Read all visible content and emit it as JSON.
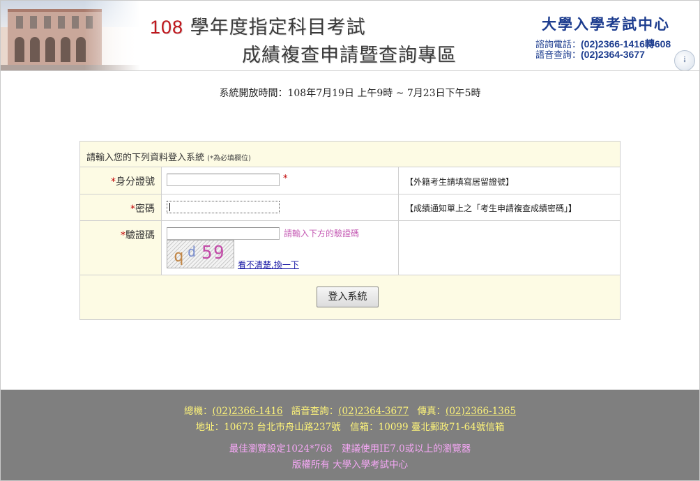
{
  "header": {
    "title_year": "108",
    "title_line1_rest": "學年度指定科目考試",
    "title_line2": "成績複查申請暨查詢專區",
    "center_name": "大學入學考試中心",
    "phone_label": "諮詢電話：",
    "phone_number": "(02)2366-1416轉608",
    "voice_label": "語音查詢：",
    "voice_number": "(02)2364-3677"
  },
  "open_time": "系統開放時間：108年7月19日 上午9時 ~ 7月23日下午5時",
  "login": {
    "caption": "請輸入您的下列資料登入系統",
    "caption_note": "(*為必填欄位)",
    "id_field": {
      "required_mark": "*",
      "label": "身分證號",
      "value": "",
      "after_mark": "*",
      "note": "【外籍考生請填寫居留證號】"
    },
    "password_field": {
      "required_mark": "*",
      "label": "密碼",
      "value": "",
      "note": "【成績通知單上之「考生申請複查成績密碼」】"
    },
    "captcha_field": {
      "required_mark": "*",
      "label": "驗證碼",
      "value": "",
      "hint": "請輸入下方的驗證碼",
      "captcha_chars": [
        "q",
        "d",
        "5",
        "9"
      ],
      "captcha_colors": [
        "#c2884a",
        "#7b8fcf",
        "#c24ca8",
        "#c24ca8"
      ],
      "refresh_link": "看不清楚,換一下"
    },
    "submit_label": "登入系統"
  },
  "footer": {
    "main_label": "總機：",
    "main_number": "(02)2366-1416",
    "voice_label": "語音查詢：",
    "voice_number": "(02)2364-3677",
    "fax_label": "傳真：",
    "fax_number": "(02)2366-1365",
    "address_line": "地址：10673 台北市舟山路237號　信箱：10099 臺北郵政71-64號信箱",
    "browser_line": "最佳瀏覽設定1024*768　建議使用IE7.0或以上的瀏覽器",
    "copyright_line": "版權所有 大學入學考試中心"
  },
  "colors": {
    "accent_red": "#c0161c",
    "brand_blue": "#1d3d8f",
    "form_bg": "#fdfbe4",
    "footer_bg": "#7f7f7f",
    "footer_yellow": "#fdf37a",
    "footer_pink": "#f4a7f4"
  }
}
